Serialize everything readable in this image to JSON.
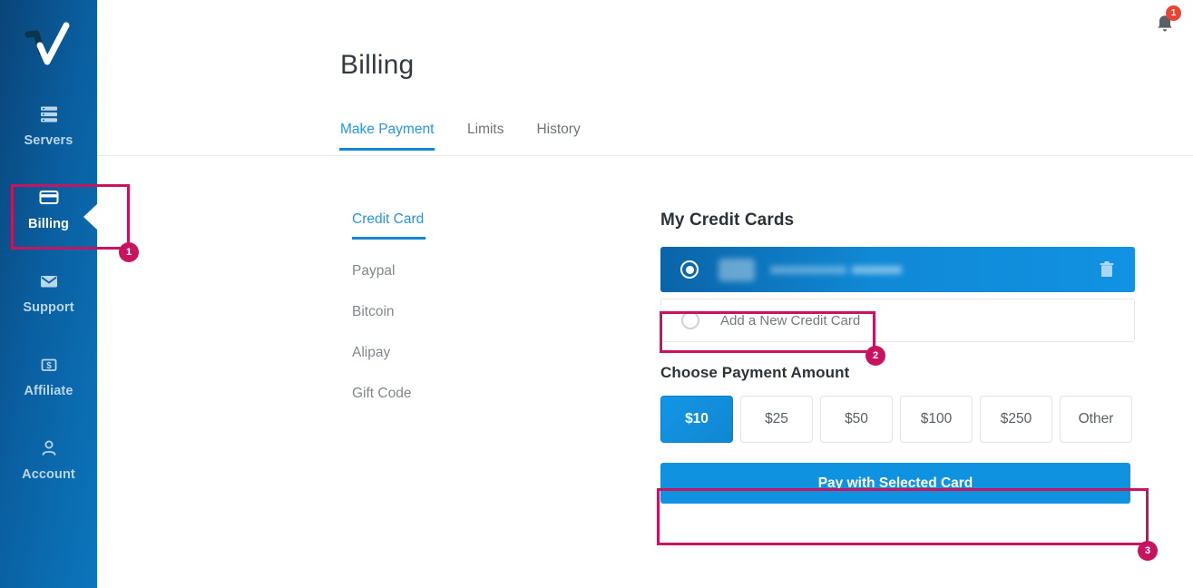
{
  "sidebar": {
    "logo": "checkmark-logo",
    "items": [
      {
        "label": "Servers",
        "icon": "server-rack-icon"
      },
      {
        "label": "Billing",
        "icon": "credit-card-icon"
      },
      {
        "label": "Support",
        "icon": "envelope-icon"
      },
      {
        "label": "Affiliate",
        "icon": "dollar-box-icon"
      },
      {
        "label": "Account",
        "icon": "person-icon"
      }
    ],
    "active": "Billing"
  },
  "topbar": {
    "bell_icon": "bell-icon",
    "notification_count": "1"
  },
  "header": {
    "title": "Billing"
  },
  "tabs": [
    {
      "label": "Make Payment",
      "active": true
    },
    {
      "label": "Limits",
      "active": false
    },
    {
      "label": "History",
      "active": false
    }
  ],
  "methods": [
    {
      "label": "Credit Card",
      "active": true
    },
    {
      "label": "Paypal",
      "active": false
    },
    {
      "label": "Bitcoin",
      "active": false
    },
    {
      "label": "Alipay",
      "active": false
    },
    {
      "label": "Gift Code",
      "active": false
    }
  ],
  "cards_panel": {
    "heading": "My Credit Cards",
    "saved_card": {
      "number_masked": "",
      "selected": true,
      "delete_icon": "trash-icon"
    },
    "add_new_label": "Add a New Credit Card",
    "amount_heading": "Choose Payment Amount",
    "amounts": [
      "$10",
      "$25",
      "$50",
      "$100",
      "$250",
      "Other"
    ],
    "selected_amount": "$10",
    "pay_button_label": "Pay with Selected Card"
  },
  "annotations": [
    {
      "number": "1",
      "target": "sidebar-item-billing"
    },
    {
      "number": "2",
      "target": "add-new-credit-card-row"
    },
    {
      "number": "3",
      "target": "pay-with-selected-card-button"
    }
  ],
  "colors": {
    "accent_blue": "#0f93e0",
    "sidebar_blue_dark": "#0a4478",
    "sidebar_blue_light": "#0c76bd",
    "annotation_pink": "#c8145f",
    "badge_red": "#ea4335"
  }
}
